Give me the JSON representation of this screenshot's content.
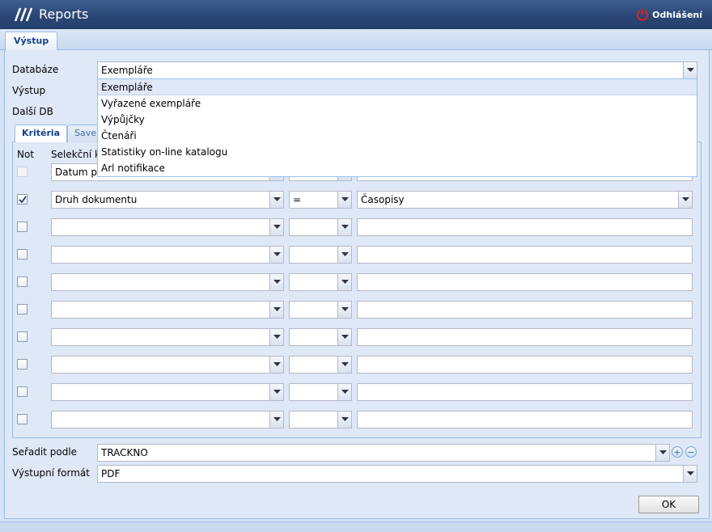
{
  "app": {
    "title": "Reports",
    "logout_label": "Odhlášení"
  },
  "tabs": {
    "main": "Výstup",
    "sub_active": "Kritéria",
    "sub_inactive": "Saveli"
  },
  "form": {
    "databaze_label": "Databáze",
    "databaze_value": "Exempláře",
    "vystup_label": "Výstup",
    "dalsi_db_label": "Další DB",
    "radit_label": "Seřadit podle",
    "radit_value": "TRACKNO",
    "format_label": "Výstupní formát",
    "format_value": "PDF",
    "ok_label": "OK",
    "add_label": "+",
    "remove_label": "−"
  },
  "dropdown": {
    "options": [
      "Exempláře",
      "Vyřazené exempláře",
      "Výpůjčky",
      "Čtenáři",
      "Statistiky on-line katalogu",
      "Arl notifikace"
    ],
    "selected_index": 0
  },
  "criteria": {
    "header_not": "Not",
    "header_selection": "Selekční kr",
    "rows": [
      {
        "checked": false,
        "disabled": true,
        "field": "Datum př",
        "operator": "",
        "value": ""
      },
      {
        "checked": true,
        "disabled": false,
        "field": "Druh dokumentu",
        "operator": "=",
        "value": "Časopisy"
      },
      {
        "checked": false,
        "disabled": false,
        "field": "",
        "operator": "",
        "value": ""
      },
      {
        "checked": false,
        "disabled": false,
        "field": "",
        "operator": "",
        "value": ""
      },
      {
        "checked": false,
        "disabled": false,
        "field": "",
        "operator": "",
        "value": ""
      },
      {
        "checked": false,
        "disabled": false,
        "field": "",
        "operator": "",
        "value": ""
      },
      {
        "checked": false,
        "disabled": false,
        "field": "",
        "operator": "",
        "value": ""
      },
      {
        "checked": false,
        "disabled": false,
        "field": "",
        "operator": "",
        "value": ""
      },
      {
        "checked": false,
        "disabled": false,
        "field": "",
        "operator": "",
        "value": ""
      },
      {
        "checked": false,
        "disabled": false,
        "field": "",
        "operator": "",
        "value": ""
      }
    ]
  },
  "colors": {
    "header_bg": "#2a4674",
    "accent": "#15428b",
    "panel_bg": "#dfe8f6",
    "logout_icon": "#e02020"
  }
}
